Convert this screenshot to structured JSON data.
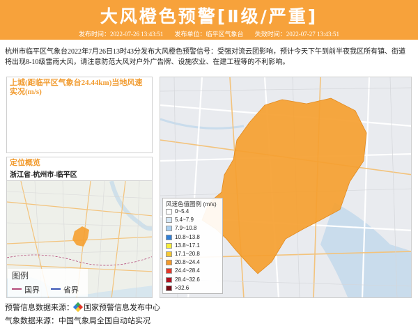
{
  "header": {
    "title": "大风橙色预警[Ⅱ级/严重]",
    "issue_time_label": "发布时间：",
    "issue_time": "2022-07-26 13:43:51",
    "issuer_label": "发布单位：",
    "issuer": "临平区气象台",
    "expire_time_label": "失效时间：",
    "expire_time": "2022-07-27 13:43:51"
  },
  "description": {
    "line1": "杭州市临平区气象台2022年7月26日13时43分发布大风橙色预警信号：受强对流云团影响，预计今天下午到前半夜我区所有镇、街道",
    "line2": "将出现8-10级雷雨大风，请注意防范大风对户外广告牌、设施农业、在建工程等的不利影响。"
  },
  "wind_panel": {
    "title_line1": "上城(距临平区气象台24.44km)当地风速",
    "title_line2": "实况(m/s)"
  },
  "location_panel": {
    "title": "定位概览",
    "region": "浙江省-杭州市-临平区"
  },
  "map_legend": {
    "title": "风速色值图例 (m/s)",
    "items": [
      {
        "label": "0~5.4",
        "color": "#ffffff"
      },
      {
        "label": "5.4~7.9",
        "color": "#d6e8f7"
      },
      {
        "label": "7.9~10.8",
        "color": "#a9d0f2"
      },
      {
        "label": "10.8~13.8",
        "color": "#2f7fd8"
      },
      {
        "label": "13.8~17.1",
        "color": "#f7ef3b"
      },
      {
        "label": "17.1~20.8",
        "color": "#f7c933"
      },
      {
        "label": "20.8~24.4",
        "color": "#f59a2a"
      },
      {
        "label": "24.4~28.4",
        "color": "#e5372a"
      },
      {
        "label": "28.4~32.6",
        "color": "#b2101f"
      },
      {
        "label": ">32.6",
        "color": "#7b0a14"
      }
    ]
  },
  "location_legend": {
    "title": "图例",
    "national_border": "国界",
    "provincial_border": "省界"
  },
  "footer": {
    "warning_source": "预警信息数据来源：",
    "warning_source_name": "国家预警信息发布中心",
    "weather_source": "气象数据来源：中国气象局全国自动站实况"
  },
  "colors": {
    "accent": "#f7a23b",
    "warning_area": "#f5a030",
    "national_border": "#b44b7a",
    "provincial_border": "#3a55b5"
  }
}
